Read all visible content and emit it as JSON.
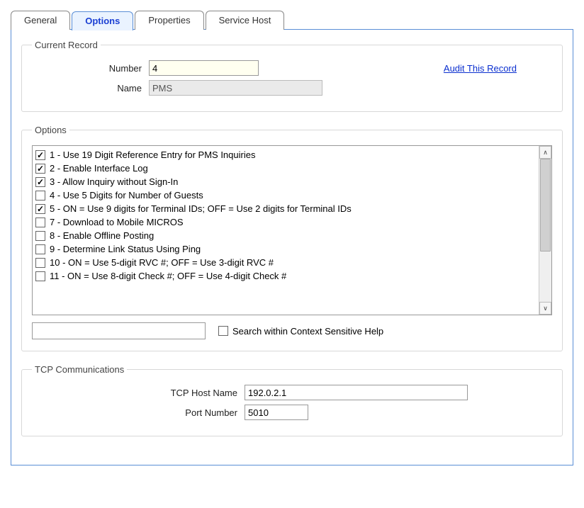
{
  "tabs": {
    "general": "General",
    "options": "Options",
    "properties": "Properties",
    "service_host": "Service Host"
  },
  "current_record": {
    "legend": "Current Record",
    "number_label": "Number",
    "number_value": "4",
    "name_label": "Name",
    "name_value": "PMS",
    "audit_link": "Audit This Record"
  },
  "options_section": {
    "legend": "Options",
    "items": [
      {
        "checked": true,
        "label": "1 - Use 19 Digit Reference Entry for PMS Inquiries"
      },
      {
        "checked": true,
        "label": "2 - Enable Interface Log"
      },
      {
        "checked": true,
        "label": "3 - Allow Inquiry without Sign-In"
      },
      {
        "checked": false,
        "label": "4 - Use 5 Digits for Number of Guests"
      },
      {
        "checked": true,
        "label": "5 - ON = Use 9 digits for Terminal IDs; OFF = Use 2 digits for Terminal IDs"
      },
      {
        "checked": false,
        "label": "7 - Download to Mobile MICROS"
      },
      {
        "checked": false,
        "label": "8 - Enable Offline Posting"
      },
      {
        "checked": false,
        "label": "9 - Determine Link Status Using Ping"
      },
      {
        "checked": false,
        "label": "10 - ON = Use 5-digit RVC #; OFF = Use 3-digit RVC #"
      },
      {
        "checked": false,
        "label": "11 - ON = Use 8-digit Check #; OFF = Use 4-digit Check #"
      }
    ],
    "search_value": "",
    "search_help_label": "Search within Context Sensitive Help"
  },
  "tcp": {
    "legend": "TCP Communications",
    "host_label": "TCP Host Name",
    "host_value": "192.0.2.1",
    "port_label": "Port Number",
    "port_value": "5010"
  }
}
